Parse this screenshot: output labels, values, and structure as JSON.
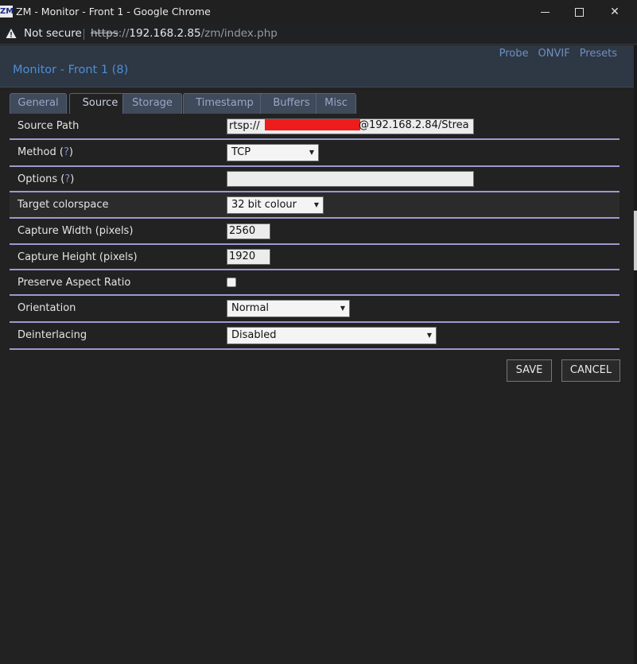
{
  "window": {
    "favicon_text": "ZM",
    "title": "ZM - Monitor - Front 1 - Google Chrome",
    "minimize_glyph": "–",
    "close_glyph": "✕"
  },
  "address_bar": {
    "security_label": "Not secure",
    "url_scheme": "https",
    "url_sep": "://",
    "url_host": "192.168.2.85",
    "url_path": "/zm/index.php"
  },
  "header": {
    "links": [
      "Probe",
      "ONVIF",
      "Presets"
    ],
    "title": "Monitor - Front 1 (8)"
  },
  "tabs": [
    {
      "label": "General",
      "active": false
    },
    {
      "label": "Source",
      "active": true
    },
    {
      "label": "Storage",
      "active": false
    },
    {
      "label": "Timestamp",
      "active": false
    },
    {
      "label": "Buffers",
      "active": false
    },
    {
      "label": "Misc",
      "active": false
    }
  ],
  "form": {
    "source_path": {
      "label": "Source Path",
      "value_prefix": "rtsp://",
      "value_suffix": "@192.168.2.84/Strea"
    },
    "method": {
      "label": "Method",
      "help": "?",
      "value": "TCP"
    },
    "options": {
      "label": "Options",
      "help": "?",
      "value": ""
    },
    "target_colorspace": {
      "label": "Target colorspace",
      "value": "32 bit colour"
    },
    "capture_width": {
      "label": "Capture Width (pixels)",
      "value": "2560"
    },
    "capture_height": {
      "label": "Capture Height (pixels)",
      "value": "1920"
    },
    "preserve_aspect": {
      "label": "Preserve Aspect Ratio",
      "checked": false
    },
    "orientation": {
      "label": "Orientation",
      "value": "Normal"
    },
    "deinterlacing": {
      "label": "Deinterlacing",
      "value": "Disabled"
    }
  },
  "buttons": {
    "save": "SAVE",
    "cancel": "CANCEL"
  },
  "colors": {
    "background": "#222222",
    "header_bg": "#2e3744",
    "accent_blue": "#4d8fd7",
    "row_divider": "#9c99cf",
    "redaction": "#ee1c1c"
  }
}
